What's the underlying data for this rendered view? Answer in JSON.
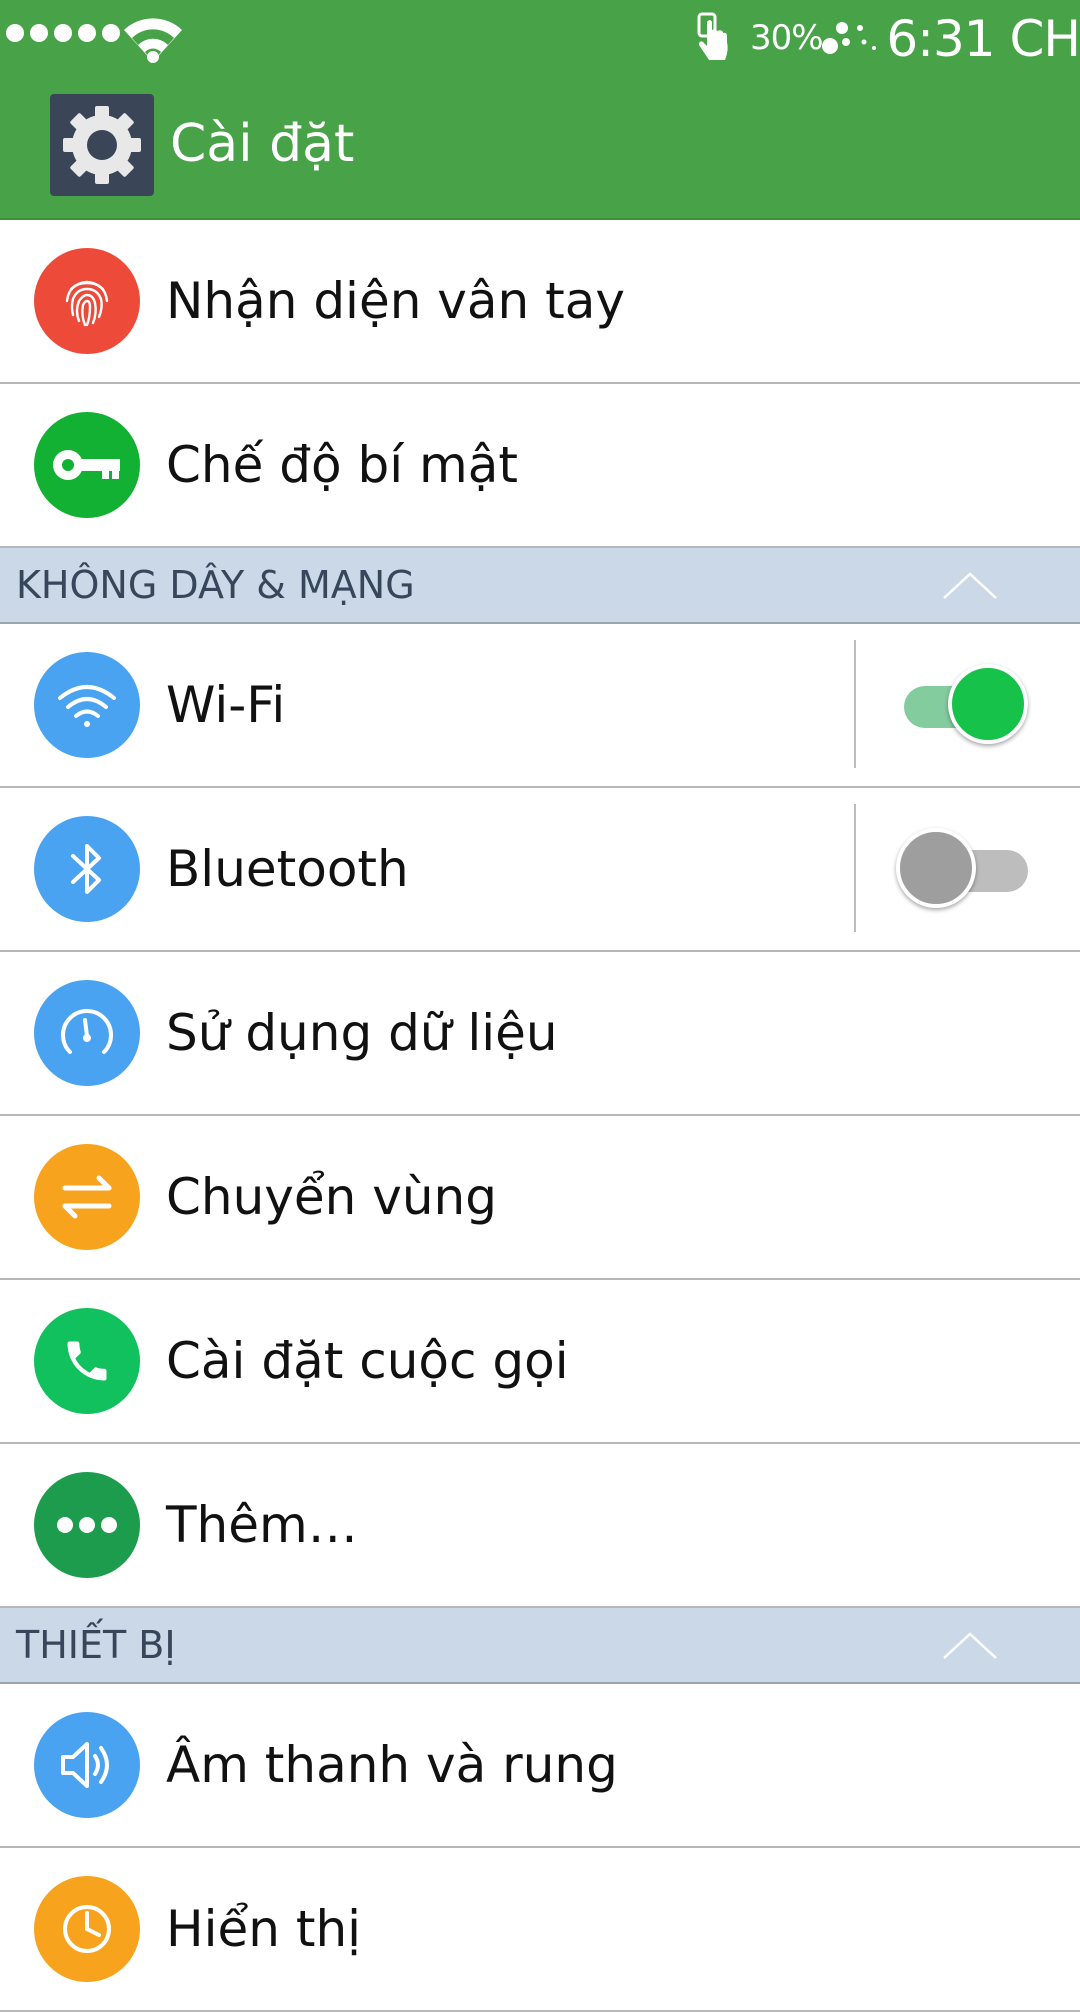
{
  "status_bar": {
    "battery": "30%",
    "time": "6:31 CH"
  },
  "app_bar": {
    "title": "Cài đặt",
    "icon": "gear-icon",
    "color": "#48a248"
  },
  "items_top": [
    {
      "label": "Nhận diện vân tay",
      "icon": "fingerprint-icon",
      "color": "#ee4a3a"
    },
    {
      "label": "Chế độ bí mật",
      "icon": "key-icon",
      "color": "#12b033"
    }
  ],
  "section_network": {
    "title": "KHÔNG DÂY & MẠNG",
    "collapse_icon": "chevron-up-icon"
  },
  "items_network": [
    {
      "label": "Wi-Fi",
      "icon": "wifi-icon",
      "color": "#4aa3f0",
      "toggle": true
    },
    {
      "label": "Bluetooth",
      "icon": "bluetooth-icon",
      "color": "#4aa3f0",
      "toggle": false
    },
    {
      "label": "Sử dụng dữ liệu",
      "icon": "speedometer-icon",
      "color": "#4aa3f0"
    },
    {
      "label": "Chuyển vùng",
      "icon": "roaming-arrows-icon",
      "color": "#f8a31e"
    },
    {
      "label": "Cài đặt cuộc gọi",
      "icon": "phone-icon",
      "color": "#11c15d"
    },
    {
      "label": "Thêm…",
      "icon": "more-dots-icon",
      "color": "#1d9c4d"
    }
  ],
  "section_device": {
    "title": "THIẾT BỊ",
    "collapse_icon": "chevron-up-icon"
  },
  "items_device": [
    {
      "label": "Âm thanh và rung",
      "icon": "speaker-icon",
      "color": "#4aa3f0"
    },
    {
      "label": "Hiển thị",
      "icon": "display-icon",
      "color": "#f8a31e"
    }
  ]
}
